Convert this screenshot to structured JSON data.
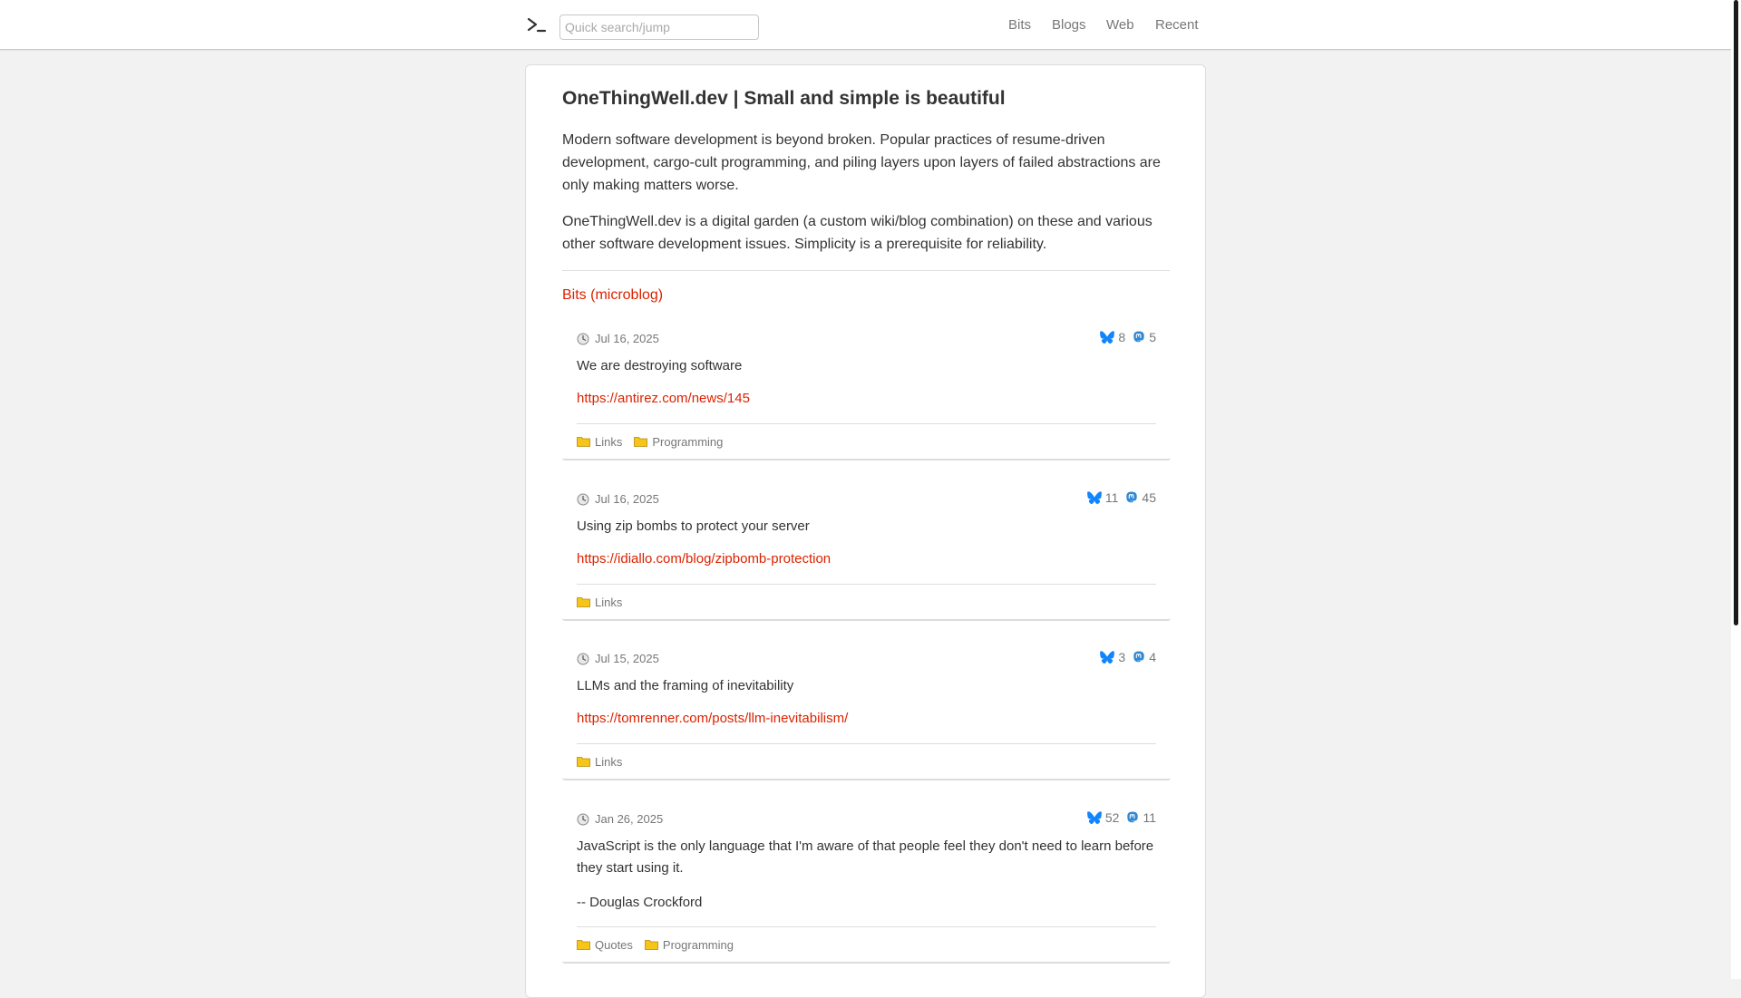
{
  "header": {
    "search_placeholder": "Quick search/jump",
    "nav": [
      "Bits",
      "Blogs",
      "Web",
      "Recent"
    ]
  },
  "intro": {
    "title": "OneThingWell.dev | Small and simple is beautiful",
    "paragraphs": [
      "Modern software development is beyond broken. Popular practices of resume-driven development, cargo-cult programming, and piling layers upon layers of failed abstractions are only making matters worse.",
      "OneThingWell.dev is a digital garden (a custom wiki/blog combination) on these and various other software development issues. Simplicity is a prerequisite for reliability."
    ],
    "section_link": "Bits (microblog)"
  },
  "posts": [
    {
      "date": "Jul 16, 2025",
      "bluesky": "8",
      "mastodon": "5",
      "text": "We are destroying software",
      "link": "https://antirez.com/news/145",
      "categories": [
        "Links",
        "Programming"
      ]
    },
    {
      "date": "Jul 16, 2025",
      "bluesky": "11",
      "mastodon": "45",
      "text": "Using zip bombs to protect your server",
      "link": "https://idiallo.com/blog/zipbomb-protection",
      "categories": [
        "Links"
      ]
    },
    {
      "date": "Jul 15, 2025",
      "bluesky": "3",
      "mastodon": "4",
      "text": "LLMs and the framing of inevitability",
      "link": "https://tomrenner.com/posts/llm-inevitabilism/",
      "categories": [
        "Links"
      ]
    },
    {
      "date": "Jan 26, 2025",
      "bluesky": "52",
      "mastodon": "11",
      "text": "JavaScript is the only language that I'm aware of that people feel they don't need to learn before they start using it.",
      "attribution": "-- Douglas Crockford",
      "categories": [
        "Quotes",
        "Programming"
      ]
    }
  ],
  "colors": {
    "accent": "#dd2200",
    "bluesky": "#1185fe",
    "mastodon": "#3088d4",
    "folder": "#f5c518"
  }
}
